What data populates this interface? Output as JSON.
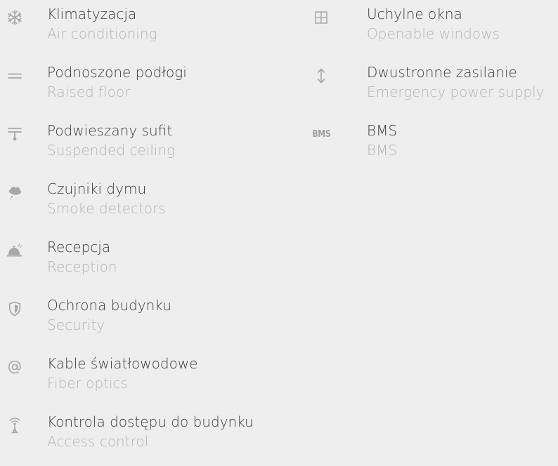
{
  "amenities_left": [
    {
      "icon": "snowflake-icon",
      "name_pl": "Klimatyzacja",
      "name_en": "Air conditioning"
    },
    {
      "icon": "raised-floor-icon",
      "name_pl": "Podnoszone podłogi",
      "name_en": "Raised floor"
    },
    {
      "icon": "suspended-ceiling-icon",
      "name_pl": "Podwieszany sufit",
      "name_en": "Suspended ceiling"
    },
    {
      "icon": "smoke-detector-icon",
      "name_pl": "Czujniki dymu",
      "name_en": "Smoke detectors"
    },
    {
      "icon": "reception-bell-icon",
      "name_pl": "Recepcja",
      "name_en": "Reception"
    },
    {
      "icon": "shield-icon",
      "name_pl": "Ochrona budynku",
      "name_en": "Security"
    },
    {
      "icon": "at-sign-icon",
      "name_pl": "Kable światłowodowe",
      "name_en": "Fiber optics"
    },
    {
      "icon": "antenna-icon",
      "name_pl": "Kontrola dostępu do budynku",
      "name_en": "Access control"
    }
  ],
  "amenities_right": [
    {
      "icon": "window-icon",
      "name_pl": "Uchylne okna",
      "name_en": "Openable windows"
    },
    {
      "icon": "up-down-arrow-icon",
      "name_pl": "Dwustronne zasilanie",
      "name_en": "Emergency power supply"
    },
    {
      "icon": "bms-icon",
      "icon_text": "BMS",
      "name_pl": "BMS",
      "name_en": "BMS"
    }
  ],
  "colors": {
    "background": "#eeeeee",
    "primary_text": "#3a3a3a",
    "secondary_text": "#b4b4b4",
    "icon": "#a8a8a8"
  }
}
